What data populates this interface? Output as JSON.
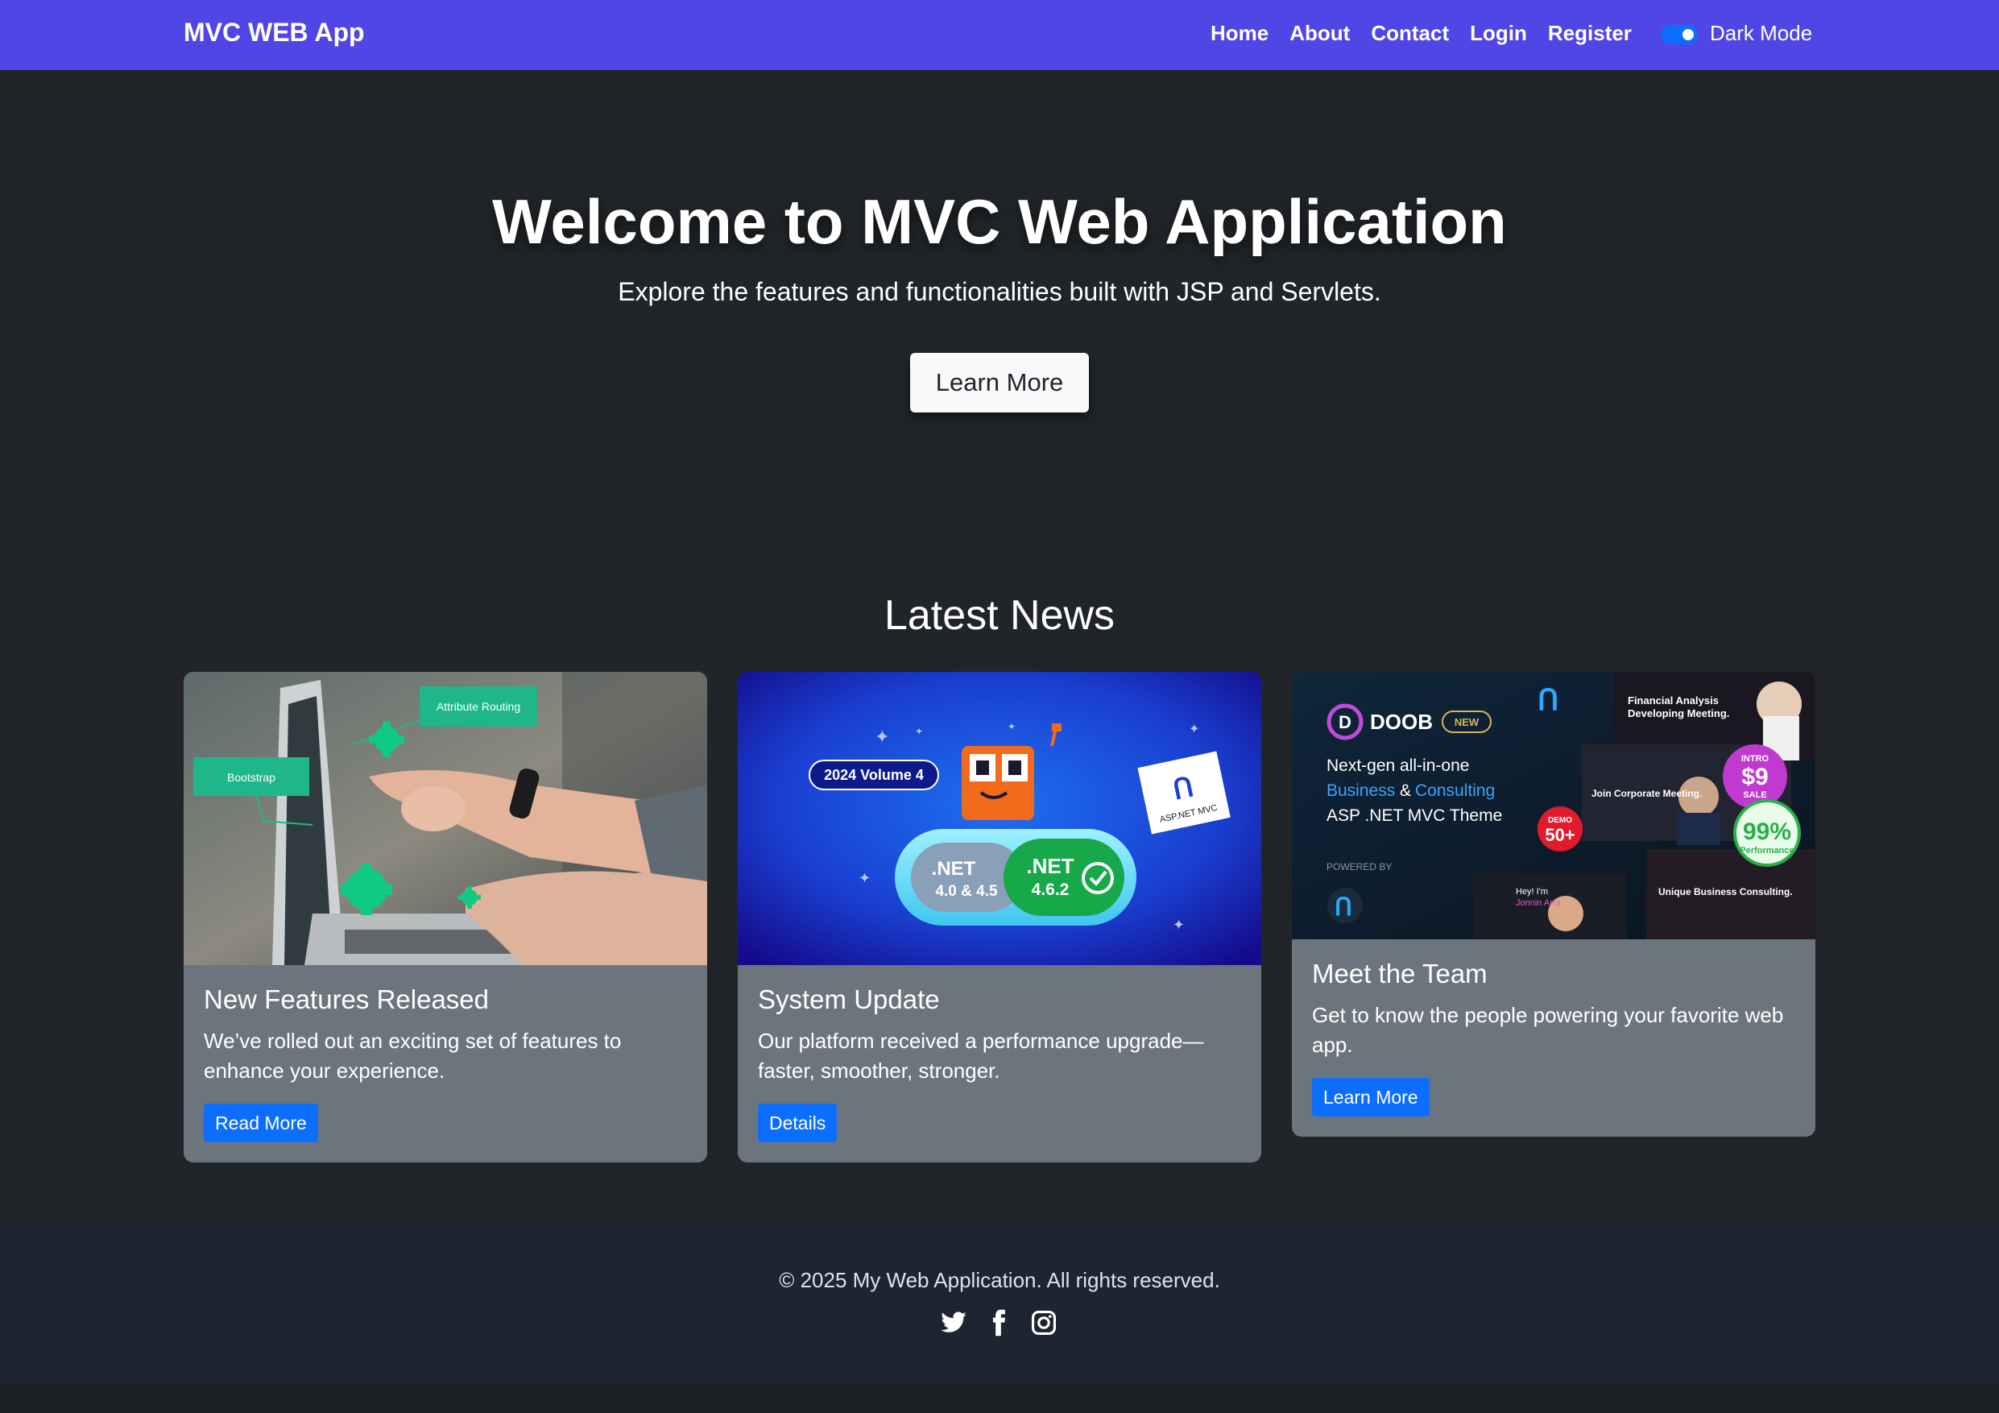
{
  "navbar": {
    "brand": "MVC WEB App",
    "links": [
      "Home",
      "About",
      "Contact",
      "Login",
      "Register"
    ],
    "dark_mode_label": "Dark Mode",
    "dark_mode_on": true,
    "color": "#4f46e5"
  },
  "hero": {
    "title": "Welcome to MVC Web Application",
    "subtitle": "Explore the features and functionalities built with JSP and Servlets.",
    "button": "Learn More"
  },
  "news": {
    "heading": "Latest News",
    "cards": [
      {
        "title": "New Features Released",
        "text": "We’ve rolled out an exciting set of features to enhance your experience.",
        "button": "Read More",
        "image": {
          "tag1": "Attribute Routing",
          "tag2": "Bootstrap"
        }
      },
      {
        "title": "System Update",
        "text": "Our platform received a performance upgrade—faster, smoother, stronger.",
        "button": "Details",
        "image": {
          "badge": "2024 Volume 4",
          "pill_left_1": ".NET",
          "pill_left_2": "4.0 & 4.5",
          "pill_right_1": ".NET",
          "pill_right_2": "4.6.2",
          "flag": "ASP.NET MVC"
        }
      },
      {
        "title": "Meet the Team",
        "text": "Get to know the people powering your favorite web app.",
        "button": "Learn More",
        "image": {
          "logo": "DOOB",
          "new_badge": "NEW",
          "line1": "Next-gen all-in-one",
          "line2a": "Business",
          "line2b": "&",
          "line2c": "Consulting",
          "line3": "ASP .NET MVC Theme",
          "powered": "POWERED BY",
          "shot1a": "Financial Analysis",
          "shot1b": "Developing Meeting.",
          "shot2": "Join Corporate Meeting.",
          "intro": "INTRO",
          "price": "$9",
          "sale": "SALE",
          "demo": "DEMO",
          "demo_count": "50+",
          "perf": "99%",
          "perf_label": "Performance",
          "hey1": "Hey! I'm",
          "hey2": "Jonnin Arra",
          "unique": "Unique Business Consulting."
        }
      }
    ]
  },
  "footer": {
    "copyright": "© 2025 My Web Application. All rights reserved.",
    "social_icons": [
      "twitter-icon",
      "facebook-icon",
      "instagram-icon"
    ]
  }
}
